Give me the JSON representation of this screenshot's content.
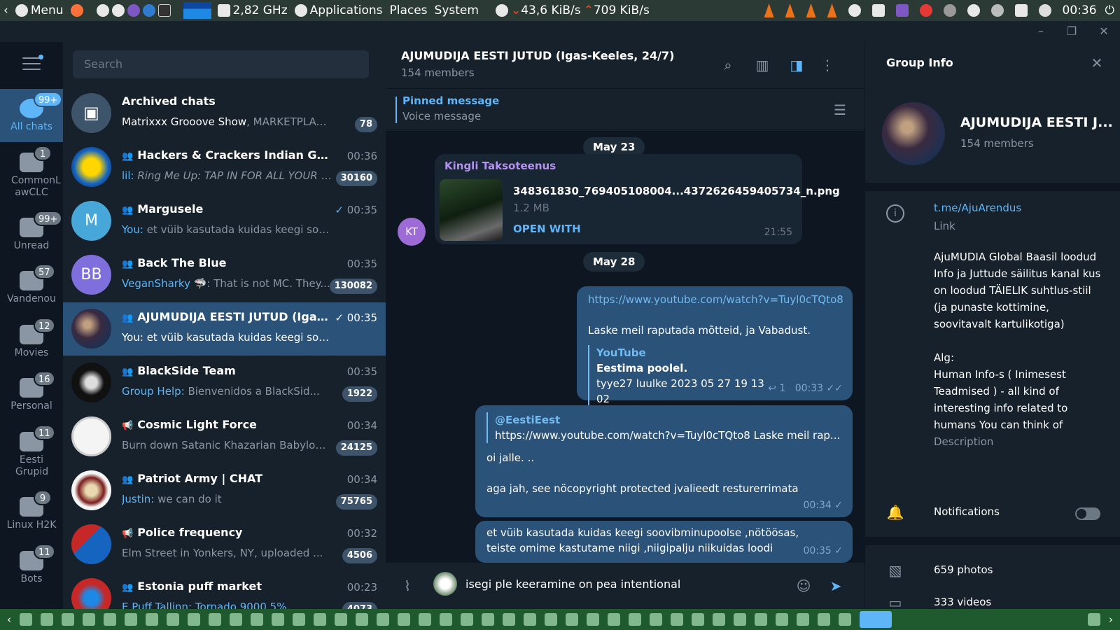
{
  "top_panel": {
    "menu_label": "Menu",
    "cpu_freq": "2,82 GHz",
    "applications": "Applications",
    "places": "Places",
    "system": "System",
    "net_down": "43,6 KiB/s",
    "net_up": "709 KiB/s",
    "clock": "00:36"
  },
  "search": {
    "placeholder": "Search"
  },
  "folders": [
    {
      "label": "All chats",
      "badge": "99+"
    },
    {
      "label": "CommonL awCLC",
      "badge": "1"
    },
    {
      "label": "Unread",
      "badge": "99+"
    },
    {
      "label": "Vandenou",
      "badge": "57"
    },
    {
      "label": "Movies",
      "badge": "12"
    },
    {
      "label": "Personal",
      "badge": "16"
    },
    {
      "label": "Eesti Grupid",
      "badge": "11"
    },
    {
      "label": "Linux H2K",
      "badge": "9"
    },
    {
      "label": "Bots",
      "badge": "11"
    }
  ],
  "chats": [
    {
      "name": "Archived chats",
      "sender": "Matrixxx Grooove Show",
      "preview": ", MARKETPLACE ...",
      "time": "",
      "badge": "78"
    },
    {
      "name": "Hackers & Crackers Indian Group",
      "sender": "lil:",
      "preview": " Ring Me Up: TAP IN FOR ALL YOUR TRA...",
      "time": "00:36",
      "badge": "30160"
    },
    {
      "name": "Margusele",
      "sender": "You:",
      "preview": " et vüib kasutada kuidas keegi soovibminu...",
      "time": "00:35",
      "badge": "",
      "avatar": "M"
    },
    {
      "name": "Back The Blue",
      "sender": "VeganSharky",
      "preview": " 🦈: That is not MC. They...",
      "time": "00:35",
      "badge": "130082",
      "avatar": "BB"
    },
    {
      "name": "AJUMUDIJA EESTI JUTUD (Igas-Ke...",
      "sender": "You:",
      "preview": " et vüib kasutada kuidas keegi soovibminu...",
      "time": "00:35",
      "badge": ""
    },
    {
      "name": "BlackSide Team",
      "sender": "Group Help:",
      "preview": " Bienvenidos a BlackSid...",
      "time": "00:35",
      "badge": "1922"
    },
    {
      "name": "Cosmic Light Force",
      "sender": "",
      "preview": "Burn down Satanic Khazarian Babylon ...",
      "time": "00:34",
      "badge": "24125"
    },
    {
      "name": "Patriot Army | CHAT",
      "sender": "Justin:",
      "preview": " we can do it",
      "time": "00:34",
      "badge": "75765"
    },
    {
      "name": "Police frequency",
      "sender": "",
      "preview": "Elm Street in Yonkers, NY, uploaded ...",
      "time": "00:32",
      "badge": "4506"
    },
    {
      "name": "Estonia puff market",
      "sender": "",
      "preview": "E Puff Tallinn: Tornado 9000 5%",
      "time": "00:23",
      "badge": "4073"
    }
  ],
  "chat_header": {
    "title": "AJUMUDIJA EESTI JUTUD (Igas-Keeles, 24/7)",
    "members": "154 members"
  },
  "pinned": {
    "title": "Pinned message",
    "text": "Voice message"
  },
  "messages": {
    "date1": "May 23",
    "msg1_sender": "Kingli Taksoteenus",
    "msg1_file": "348361830_769405108004...4372626459405734_n.png",
    "msg1_size": "1.2 MB",
    "msg1_action": "OPEN WITH",
    "msg1_time": "21:55",
    "msg1_avatar": "KT",
    "date2": "May 28",
    "msg2_link": "https://www.youtube.com/watch?v=Tuyl0cTQto8",
    "msg2_text": "Laske meil raputada mõtteid, ja Vabadust.",
    "msg2_preview_site": "YouTube",
    "msg2_preview_title": "Eestima poolel.",
    "msg2_preview_desc": "tyye27 luulke 2023 05 27 19 13 02",
    "msg2_replies": "1",
    "msg2_time": "00:33",
    "msg3_quote_author": "@EestiEest",
    "msg3_quote_text": "https://www.youtube.com/watch?v=Tuyl0cTQto8   Laske meil rap...",
    "msg3_line1": "oi jalle. ..",
    "msg3_line2": "aga jah, see nöcopyright protected jvalieedt resturerrimata",
    "msg3_time": "00:34",
    "msg4_text": "et vüib kasutada kuidas keegi soovibminupoolse ,nötöösas, teiste omime kastutame niigi ,niigipalju niikuidas loodi",
    "msg4_time": "00:35"
  },
  "composer": {
    "text": "isegi ple keeramine on pea intentional"
  },
  "group_info": {
    "heading": "Group Info",
    "name": "AJUMUDIJA EESTI J...",
    "members": "154 members",
    "link": "t.me/AjuArendus",
    "link_label": "Link",
    "description": "AjuMUDIA Global Baasil loodud Info ja Juttude säilitus kanal kus on loodud TÄIELIK suhtlus-stiil (ja punaste kottimine, soovitavalt kartulikotiga)",
    "alg_title": "Alg:",
    "alg_text": "Human Info-s ( Inimesest Teadmised ) - all kind of interesting info related to humans You can think of",
    "description_label": "Description",
    "notifications": "Notifications",
    "photos": "659 photos",
    "videos": "333 videos"
  }
}
